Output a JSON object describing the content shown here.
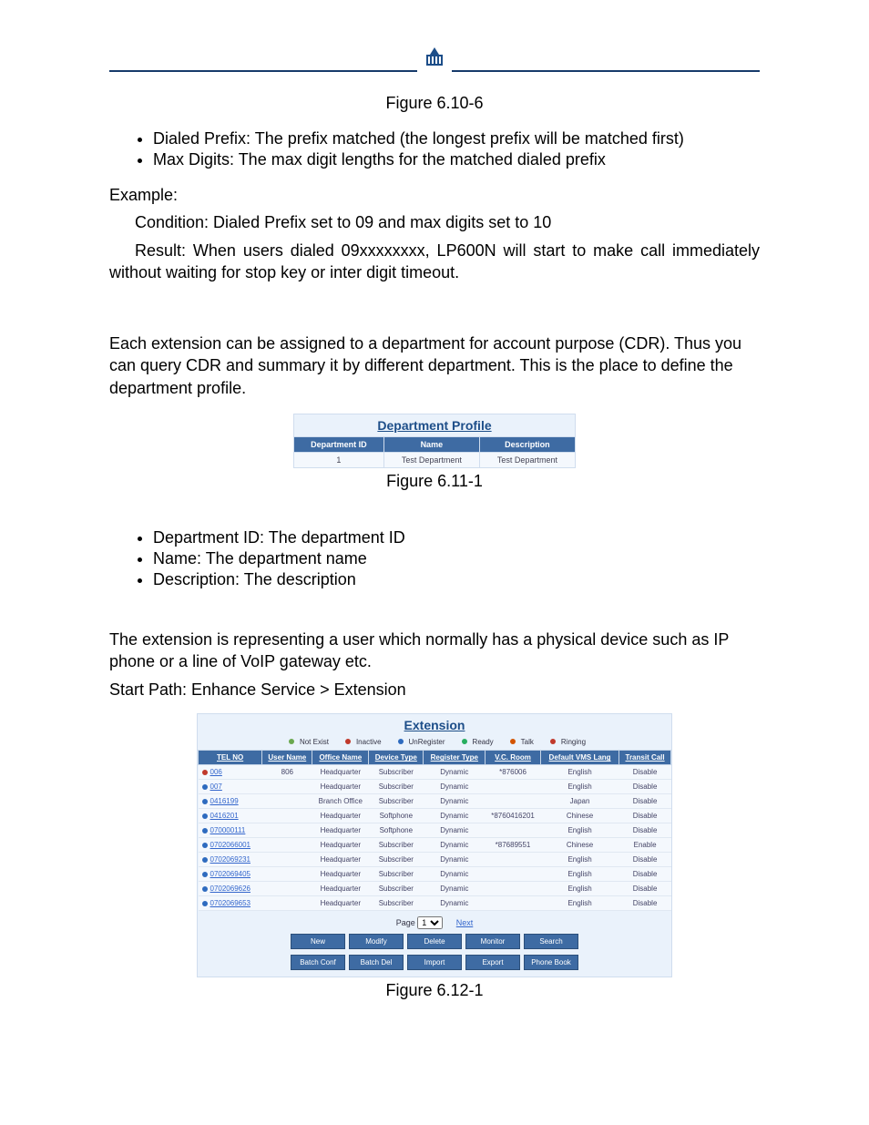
{
  "figures": {
    "f1": "Figure 6.10-6",
    "f2": "Figure 6.11-1",
    "f3": "Figure 6.12-1"
  },
  "bullets1": [
    "Dialed Prefix: The prefix matched (the longest prefix will be matched first)",
    "Max Digits: The max digit lengths for the matched dialed prefix"
  ],
  "example": {
    "label": "Example:",
    "cond": "Condition: Dialed Prefix set to 09 and max digits set to 10",
    "result": "Result: When users dialed 09xxxxxxxx, LP600N will start to make call immediately without waiting for stop key or inter digit timeout."
  },
  "para_dept": "Each extension can be assigned to a department for account purpose (CDR). Thus you can query CDR and summary it by different department. This is the place to define the department profile.",
  "dept_table": {
    "title": "Department Profile",
    "headers": [
      "Department ID",
      "Name",
      "Description"
    ],
    "row": [
      "1",
      "Test Department",
      "Test Department"
    ]
  },
  "bullets2": [
    "Department ID: The department ID",
    "Name: The department name",
    "Description: The description"
  ],
  "para_ext": "The extension is representing a user which normally has a physical device such as IP phone or a line of VoIP gateway etc.",
  "start_path": "Start Path: Enhance Service > Extension",
  "ext": {
    "title": "Extension",
    "legend": [
      {
        "label": "Not Exist",
        "color": "#6aa84f"
      },
      {
        "label": "Inactive",
        "color": "#c0392b"
      },
      {
        "label": "UnRegister",
        "color": "#2e6bbf"
      },
      {
        "label": "Ready",
        "color": "#27ae60"
      },
      {
        "label": "Talk",
        "color": "#d35400"
      },
      {
        "label": "Ringing",
        "color": "#c0392b"
      }
    ],
    "headers": [
      "TEL NO",
      "User Name",
      "Office Name",
      "Device Type",
      "Register Type",
      "V.C. Room",
      "Default VMS Lang",
      "Transit Call"
    ],
    "rows": [
      {
        "st": "#c0392b",
        "tel": "006",
        "user": "806",
        "office": "Headquarter",
        "dev": "Subscriber",
        "reg": "Dynamic",
        "vc": "*876006",
        "lang": "English",
        "tc": "Disable"
      },
      {
        "st": "#2e6bbf",
        "tel": "007",
        "user": "",
        "office": "Headquarter",
        "dev": "Subscriber",
        "reg": "Dynamic",
        "vc": "",
        "lang": "English",
        "tc": "Disable"
      },
      {
        "st": "#2e6bbf",
        "tel": "0416199",
        "user": "",
        "office": "Branch Office",
        "dev": "Subscriber",
        "reg": "Dynamic",
        "vc": "",
        "lang": "Japan",
        "tc": "Disable"
      },
      {
        "st": "#2e6bbf",
        "tel": "0416201",
        "user": "",
        "office": "Headquarter",
        "dev": "Softphone",
        "reg": "Dynamic",
        "vc": "*8760416201",
        "lang": "Chinese",
        "tc": "Disable"
      },
      {
        "st": "#2e6bbf",
        "tel": "070000111",
        "user": "",
        "office": "Headquarter",
        "dev": "Softphone",
        "reg": "Dynamic",
        "vc": "",
        "lang": "English",
        "tc": "Disable"
      },
      {
        "st": "#2e6bbf",
        "tel": "0702066001",
        "user": "",
        "office": "Headquarter",
        "dev": "Subscriber",
        "reg": "Dynamic",
        "vc": "*87689551",
        "lang": "Chinese",
        "tc": "Enable"
      },
      {
        "st": "#2e6bbf",
        "tel": "0702069231",
        "user": "",
        "office": "Headquarter",
        "dev": "Subscriber",
        "reg": "Dynamic",
        "vc": "",
        "lang": "English",
        "tc": "Disable"
      },
      {
        "st": "#2e6bbf",
        "tel": "0702069405",
        "user": "",
        "office": "Headquarter",
        "dev": "Subscriber",
        "reg": "Dynamic",
        "vc": "",
        "lang": "English",
        "tc": "Disable"
      },
      {
        "st": "#2e6bbf",
        "tel": "0702069626",
        "user": "",
        "office": "Headquarter",
        "dev": "Subscriber",
        "reg": "Dynamic",
        "vc": "",
        "lang": "English",
        "tc": "Disable"
      },
      {
        "st": "#2e6bbf",
        "tel": "0702069653",
        "user": "",
        "office": "Headquarter",
        "dev": "Subscriber",
        "reg": "Dynamic",
        "vc": "",
        "lang": "English",
        "tc": "Disable"
      }
    ],
    "pager": {
      "label": "Page",
      "value": "1",
      "next": "Next"
    },
    "buttons_row1": [
      "New",
      "Modify",
      "Delete",
      "Monitor",
      "Search"
    ],
    "buttons_row2": [
      "Batch Conf",
      "Batch Del",
      "Import",
      "Export",
      "Phone Book"
    ]
  }
}
